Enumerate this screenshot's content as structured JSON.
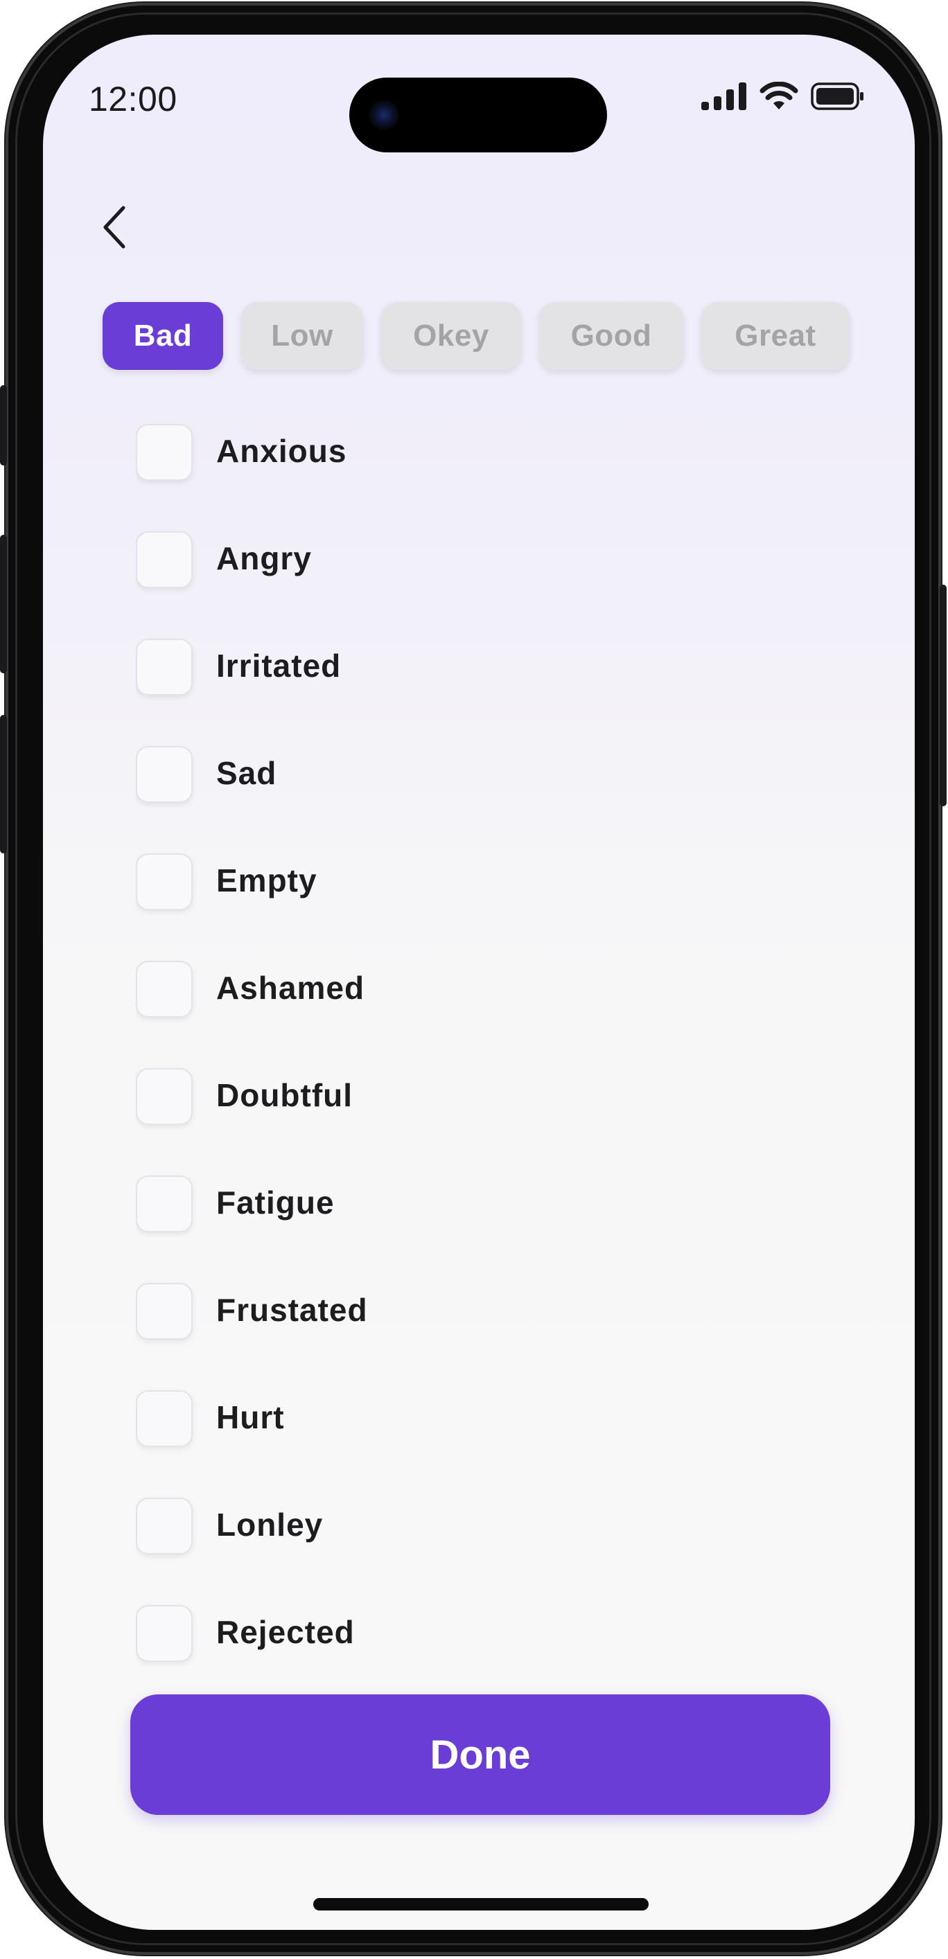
{
  "status_bar": {
    "time": "12:00",
    "icons": [
      "cellular-signal-icon",
      "wifi-icon",
      "battery-icon"
    ]
  },
  "header": {
    "back_icon": "chevron-left-icon"
  },
  "mood_tabs": [
    {
      "label": "Bad",
      "active": true
    },
    {
      "label": "Low",
      "active": false
    },
    {
      "label": "Okey",
      "active": false
    },
    {
      "label": "Good",
      "active": false
    },
    {
      "label": "Great",
      "active": false
    }
  ],
  "feelings": [
    {
      "label": "Anxious",
      "checked": false
    },
    {
      "label": "Angry",
      "checked": false
    },
    {
      "label": "Irritated",
      "checked": false
    },
    {
      "label": "Sad",
      "checked": false
    },
    {
      "label": "Empty",
      "checked": false
    },
    {
      "label": "Ashamed",
      "checked": false
    },
    {
      "label": "Doubtful",
      "checked": false
    },
    {
      "label": "Fatigue",
      "checked": false
    },
    {
      "label": "Frustated",
      "checked": false
    },
    {
      "label": "Hurt",
      "checked": false
    },
    {
      "label": "Lonley",
      "checked": false
    },
    {
      "label": "Rejected",
      "checked": false
    }
  ],
  "done_button": {
    "label": "Done"
  },
  "colors": {
    "accent": "#6a3dd6",
    "tab_inactive_bg": "#e3e3e6",
    "tab_inactive_text": "#a3a3a8",
    "text": "#1d1d20"
  }
}
